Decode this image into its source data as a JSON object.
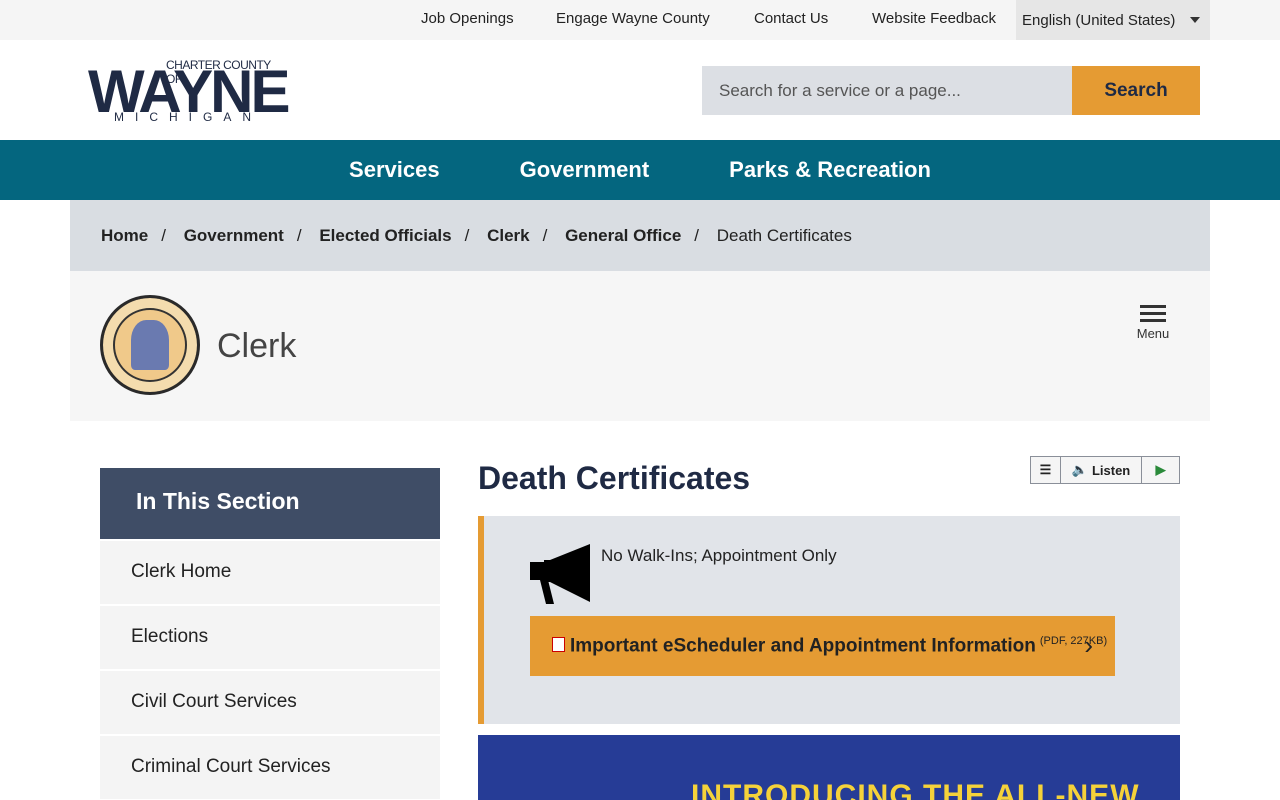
{
  "topbar": {
    "links": [
      "Job Openings",
      "Engage Wayne County",
      "Contact Us",
      "Website Feedback"
    ],
    "language": "English (United States)"
  },
  "logo": {
    "charter": "CHARTER COUNTY OF",
    "wayne": "WAYNE",
    "michigan": "MICHIGAN"
  },
  "search": {
    "placeholder": "Search for a service or a page...",
    "button": "Search"
  },
  "nav": [
    "Services",
    "Government",
    "Parks & Recreation"
  ],
  "breadcrumb": [
    "Home",
    "Government",
    "Elected Officials",
    "Clerk",
    "General Office"
  ],
  "breadcrumb_current": "Death Certificates",
  "department": {
    "name": "Clerk",
    "menu": "Menu"
  },
  "sidebar": {
    "title": "In This Section",
    "items": [
      "Clerk Home",
      "Elections",
      "Civil Court Services",
      "Criminal Court Services"
    ]
  },
  "page": {
    "title": "Death Certificates",
    "listen": "Listen"
  },
  "alert": {
    "text": "No Walk-Ins; Appointment Only",
    "link": "Important eScheduler and Appointment Information",
    "link_meta": "(PDF, 227KB)"
  },
  "banner": {
    "text": "INTRODUCING THE ALL-NEW"
  },
  "colors": {
    "nav": "#04667f",
    "accent": "#e59b33",
    "sidebar_head": "#3f4d66"
  }
}
